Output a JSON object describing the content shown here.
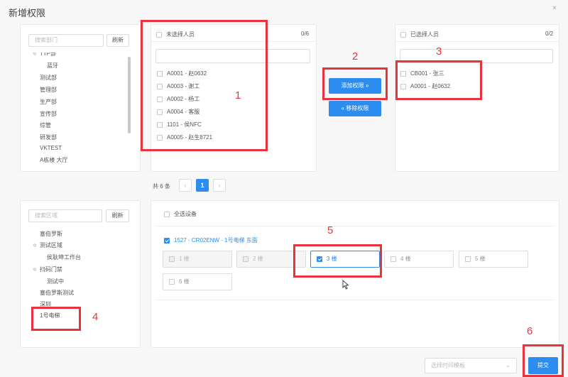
{
  "dialog": {
    "title": "新增权限",
    "close_glyph": "×"
  },
  "dept": {
    "search_placeholder": "搜索部门",
    "refresh_label": "刷新",
    "items": [
      {
        "label": "TTP部",
        "expander": "✲",
        "indent": 1
      },
      {
        "label": "蓝牙",
        "expander": "",
        "indent": 2
      },
      {
        "label": "测试部",
        "expander": "",
        "indent": 1
      },
      {
        "label": "管理部",
        "expander": "",
        "indent": 1
      },
      {
        "label": "生产部",
        "expander": "",
        "indent": 1
      },
      {
        "label": "宣传部",
        "expander": "",
        "indent": 1
      },
      {
        "label": "综管",
        "expander": "",
        "indent": 1
      },
      {
        "label": "研发部",
        "expander": "",
        "indent": 1
      },
      {
        "label": "VKTEST",
        "expander": "",
        "indent": 1
      },
      {
        "label": "A栋楼 大厅",
        "expander": "",
        "indent": 1
      }
    ]
  },
  "unselected": {
    "header": "未选择人员",
    "count": "0/6",
    "items": [
      "A0001 - 赵0632",
      "A0003 - 谢工",
      "A0002 - 杨工",
      "A0004 - 客服",
      "1101 - 侯NFC",
      "A0005 - 赵生8721"
    ]
  },
  "actions": {
    "add_label": "添加权限 »",
    "remove_label": "« 移除权限"
  },
  "selected": {
    "header": "已选择人员",
    "count": "0/2",
    "items": [
      "CB001 - 张三",
      "A0001 - 赵0632"
    ]
  },
  "pager": {
    "total": "共 6 条",
    "prev": "‹",
    "current": "1",
    "next": "›"
  },
  "area": {
    "search_placeholder": "搜索区域",
    "refresh_label": "刷新",
    "items": [
      {
        "label": "塞伯罗斯",
        "expander": "",
        "indent": 1
      },
      {
        "label": "测试区域",
        "expander": "✲",
        "indent": 1
      },
      {
        "label": "侯耿坤工作台",
        "expander": "",
        "indent": 2
      },
      {
        "label": "扫码门禁",
        "expander": "✲",
        "indent": 1
      },
      {
        "label": "测试中",
        "expander": "",
        "indent": 2
      },
      {
        "label": "塞伯罗斯测试",
        "expander": "",
        "indent": 1
      },
      {
        "label": "深圳",
        "expander": "",
        "indent": 1
      },
      {
        "label": "1号电梯",
        "expander": "",
        "indent": 1
      }
    ]
  },
  "devices": {
    "select_all_label": "全选设备",
    "device_label": "1527 - CR02ENW - 1号电梯 东面",
    "floors": [
      {
        "label": "1 楼",
        "state": "disabled"
      },
      {
        "label": "2 楼",
        "state": "disabled"
      },
      {
        "label": "3 楼",
        "state": "selected"
      },
      {
        "label": "4 楼",
        "state": "normal"
      },
      {
        "label": "5 楼",
        "state": "normal"
      },
      {
        "label": "6 楼",
        "state": "normal"
      }
    ]
  },
  "footer": {
    "time_template_placeholder": "选择时间模板",
    "submit_label": "提交"
  },
  "annotations": [
    "1",
    "2",
    "3",
    "4",
    "5",
    "6"
  ],
  "colors": {
    "accent": "#2d8cf0",
    "annotation": "#e8323c"
  }
}
